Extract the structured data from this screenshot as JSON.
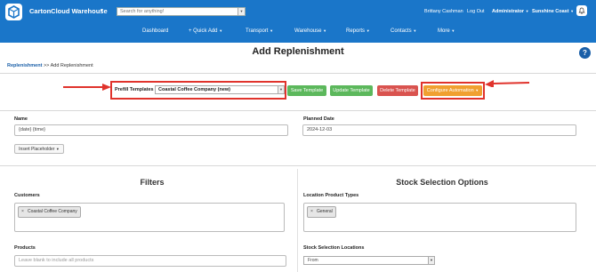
{
  "app": {
    "name": "CartonCloud Warehouse",
    "search_placeholder": "Search for anything!",
    "user_name": "Brittany Cashman",
    "logout": "Log Out",
    "role": "Administrator",
    "warehouse": "Sunshine Coast"
  },
  "nav": {
    "dashboard": "Dashboard",
    "quick_add": "+ Quick Add",
    "transport": "Transport",
    "warehouse": "Warehouse",
    "reports": "Reports",
    "contacts": "Contacts",
    "more": "More"
  },
  "page": {
    "breadcrumb_link": "Replenishment",
    "breadcrumb_rest": " >> Add Replenishment",
    "title": "Add Replenishment",
    "help": "?"
  },
  "templates": {
    "label": "Prefill Templates",
    "selected": "Coastal Coffee Company (new)",
    "save": "Save Template",
    "update": "Update Template",
    "delete": "Delete Template",
    "configure": "Configure Automation"
  },
  "form": {
    "name_label": "Name",
    "name_value": "{date} {time}",
    "planned_date_label": "Planned Date",
    "planned_date_value": "2024-12-03",
    "insert_placeholder": "Insert Placeholder"
  },
  "filters": {
    "title": "Filters",
    "customers_label": "Customers",
    "customers": [
      "Coastal Coffee Company"
    ],
    "products_label": "Products",
    "products_placeholder": "Leave blank to include all products"
  },
  "stock": {
    "title": "Stock Selection Options",
    "location_types_label": "Location Product Types",
    "location_types": [
      "General"
    ],
    "locations_label": "Stock Selection Locations",
    "locations_value": "From"
  },
  "colors": {
    "brand": "#1a76c9",
    "green": "#5cb85c",
    "red": "#d9534f",
    "orange": "#f0a030",
    "annotation": "#e0332c"
  }
}
